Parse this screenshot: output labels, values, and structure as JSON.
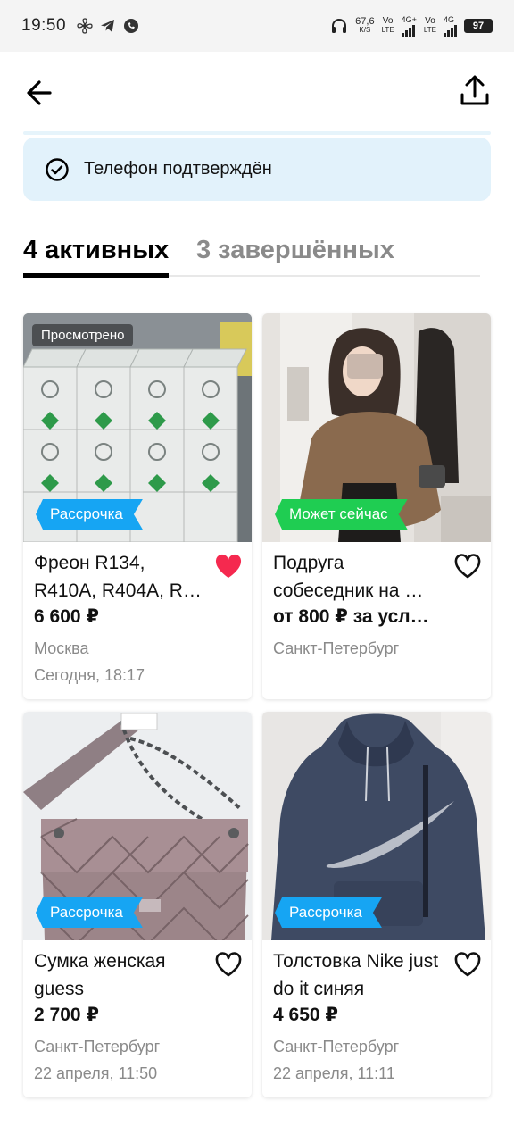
{
  "status_bar": {
    "time": "19:50",
    "net_speed_value": "67,6",
    "net_speed_unit": "K/S",
    "sim1_label": "Vo",
    "sim1_sub": "LTE",
    "sim1_gen": "4G+",
    "sim2_label": "Vo",
    "sim2_sub": "LTE",
    "sim2_gen": "4G",
    "battery": "97"
  },
  "verified": {
    "text": "Телефон подтверждён"
  },
  "tabs": [
    {
      "label": "4 активных",
      "active": true
    },
    {
      "label": "3 завершённых",
      "active": false
    }
  ],
  "listings": [
    {
      "title": "Фреон R134, R410A, R404A, R…",
      "price": "6 600 ₽",
      "city": "Москва",
      "date": "Сегодня, 18:17",
      "badge": "Просмотрено",
      "ribbon": "Рассрочка",
      "ribbon_color": "#16a5f3",
      "favorited": true
    },
    {
      "title": "Подруга собеседник на …",
      "price": "от 800 ₽ за усл…",
      "city": "Санкт-Петербург",
      "date": "",
      "badge": "",
      "ribbon": "Может сейчас",
      "ribbon_color": "#1fcd52",
      "favorited": false
    },
    {
      "title": "Сумка женская guess",
      "price": "2 700 ₽",
      "city": "Санкт-Петербург",
      "date": "22 апреля, 11:50",
      "badge": "",
      "ribbon": "Рассрочка",
      "ribbon_color": "#16a5f3",
      "favorited": false
    },
    {
      "title": "Толстовка Nike just do it синяя",
      "price": "4 650 ₽",
      "city": "Санкт-Петербург",
      "date": "22 апреля, 11:11",
      "badge": "",
      "ribbon": "Рассрочка",
      "ribbon_color": "#16a5f3",
      "favorited": false
    }
  ],
  "colors": {
    "heart_active": "#f5294f",
    "accent_blue": "#16a5f3",
    "accent_green": "#1fcd52",
    "verified_bg": "#e2f2fb"
  }
}
